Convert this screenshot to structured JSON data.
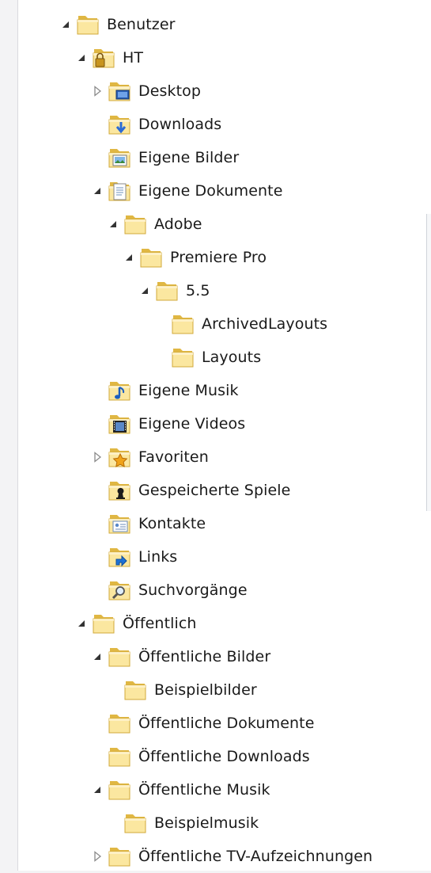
{
  "tree": [
    {
      "label": "Benutzer",
      "level": 0,
      "state": "expanded",
      "icon": "folder-icon"
    },
    {
      "label": "HT",
      "level": 1,
      "state": "expanded",
      "icon": "user-folder-lock-icon"
    },
    {
      "label": "Desktop",
      "level": 2,
      "state": "collapsed",
      "icon": "desktop-folder-icon"
    },
    {
      "label": "Downloads",
      "level": 2,
      "state": "none",
      "icon": "downloads-folder-icon"
    },
    {
      "label": "Eigene Bilder",
      "level": 2,
      "state": "none",
      "icon": "pictures-folder-icon"
    },
    {
      "label": "Eigene Dokumente",
      "level": 2,
      "state": "expanded",
      "icon": "documents-folder-icon"
    },
    {
      "label": "Adobe",
      "level": 3,
      "state": "expanded",
      "icon": "folder-icon"
    },
    {
      "label": "Premiere Pro",
      "level": 4,
      "state": "expanded",
      "icon": "folder-icon"
    },
    {
      "label": "5.5",
      "level": 5,
      "state": "expanded",
      "icon": "folder-icon"
    },
    {
      "label": "ArchivedLayouts",
      "level": 6,
      "state": "none",
      "icon": "folder-icon"
    },
    {
      "label": "Layouts",
      "level": 6,
      "state": "none",
      "icon": "folder-icon"
    },
    {
      "label": "Eigene Musik",
      "level": 2,
      "state": "none",
      "icon": "music-folder-icon"
    },
    {
      "label": "Eigene Videos",
      "level": 2,
      "state": "none",
      "icon": "videos-folder-icon"
    },
    {
      "label": "Favoriten",
      "level": 2,
      "state": "collapsed",
      "icon": "favorites-folder-icon"
    },
    {
      "label": "Gespeicherte Spiele",
      "level": 2,
      "state": "none",
      "icon": "saved-games-folder-icon"
    },
    {
      "label": "Kontakte",
      "level": 2,
      "state": "none",
      "icon": "contacts-folder-icon"
    },
    {
      "label": "Links",
      "level": 2,
      "state": "none",
      "icon": "links-folder-icon"
    },
    {
      "label": "Suchvorgänge",
      "level": 2,
      "state": "none",
      "icon": "searches-folder-icon"
    },
    {
      "label": "Öffentlich",
      "level": 1,
      "state": "expanded",
      "icon": "folder-icon"
    },
    {
      "label": "Öffentliche Bilder",
      "level": 2,
      "state": "expanded",
      "icon": "folder-icon"
    },
    {
      "label": "Beispielbilder",
      "level": 3,
      "state": "none",
      "icon": "folder-icon"
    },
    {
      "label": "Öffentliche Dokumente",
      "level": 2,
      "state": "none",
      "icon": "folder-icon"
    },
    {
      "label": "Öffentliche Downloads",
      "level": 2,
      "state": "none",
      "icon": "folder-icon"
    },
    {
      "label": "Öffentliche Musik",
      "level": 2,
      "state": "expanded",
      "icon": "folder-icon"
    },
    {
      "label": "Beispielmusik",
      "level": 3,
      "state": "none",
      "icon": "folder-icon"
    },
    {
      "label": "Öffentliche TV-Aufzeichnungen",
      "level": 2,
      "state": "collapsed",
      "icon": "folder-icon"
    }
  ],
  "colors": {
    "folder_light": "#fbe7a0",
    "folder_dark": "#e0b743",
    "text": "#1a1a1a",
    "arrow": "#333333",
    "arrow_hollow": "#8a8a8a"
  }
}
